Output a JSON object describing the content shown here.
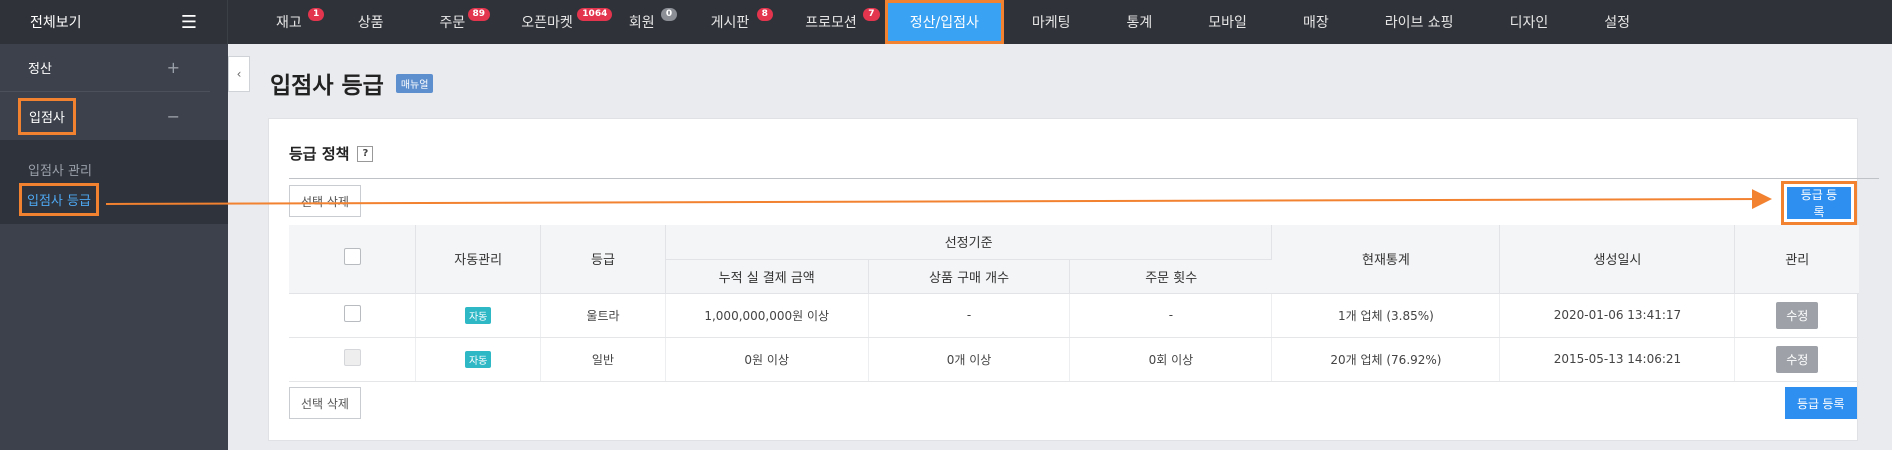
{
  "topbar": {
    "allview_label": "전체보기",
    "nav": [
      {
        "label": "재고",
        "badge": "1"
      },
      {
        "label": "상품",
        "badge": ""
      },
      {
        "label": "주문",
        "badge": "89"
      },
      {
        "label": "오픈마켓",
        "badge": "1064"
      },
      {
        "label": "회원",
        "badge": "0"
      },
      {
        "label": "게시판",
        "badge": "8"
      },
      {
        "label": "프로모션",
        "badge": "7"
      },
      {
        "label": "정산/입점사",
        "badge": ""
      },
      {
        "label": "마케팅",
        "badge": ""
      },
      {
        "label": "통계",
        "badge": ""
      },
      {
        "label": "모바일",
        "badge": ""
      },
      {
        "label": "매장",
        "badge": ""
      },
      {
        "label": "라이브 쇼핑",
        "badge": ""
      },
      {
        "label": "디자인",
        "badge": ""
      },
      {
        "label": "설정",
        "badge": ""
      }
    ],
    "active_index": 7
  },
  "sidebar": {
    "groups": [
      {
        "label": "정산",
        "sign": "+"
      },
      {
        "label": "입점사",
        "sign": "−"
      }
    ],
    "sub_items": [
      {
        "label": "입점사 관리"
      },
      {
        "label": "입점사 등급"
      }
    ]
  },
  "page": {
    "title": "입점사 등급",
    "manual_badge": "매뉴얼"
  },
  "panel": {
    "title": "등급 정책",
    "help": "?",
    "delete_label": "선택 삭제",
    "register_label": "등급 등록"
  },
  "table": {
    "headers": {
      "auto": "자동관리",
      "grade": "등급",
      "criteria": "선정기준",
      "amount": "누적 실 결제 금액",
      "purchase": "상품 구매 개수",
      "orders": "주문 횟수",
      "stats": "현재통계",
      "created": "생성일시",
      "manage": "관리"
    },
    "rows": [
      {
        "auto": "자동",
        "grade": "울트라",
        "amount": "1,000,000,000원 이상",
        "purchase": "-",
        "orders": "-",
        "stats": "1개 업체 (3.85%)",
        "created": "2020-01-06 13:41:17",
        "edit": "수정"
      },
      {
        "auto": "자동",
        "grade": "일반",
        "amount": "0원 이상",
        "purchase": "0개 이상",
        "orders": "0회 이상",
        "stats": "20개 업체 (76.92%)",
        "created": "2015-05-13 14:06:21",
        "edit": "수정"
      }
    ]
  },
  "colors": {
    "accent": "#2e8ff0",
    "highlight": "#f28130",
    "badge": "#e4354e"
  }
}
